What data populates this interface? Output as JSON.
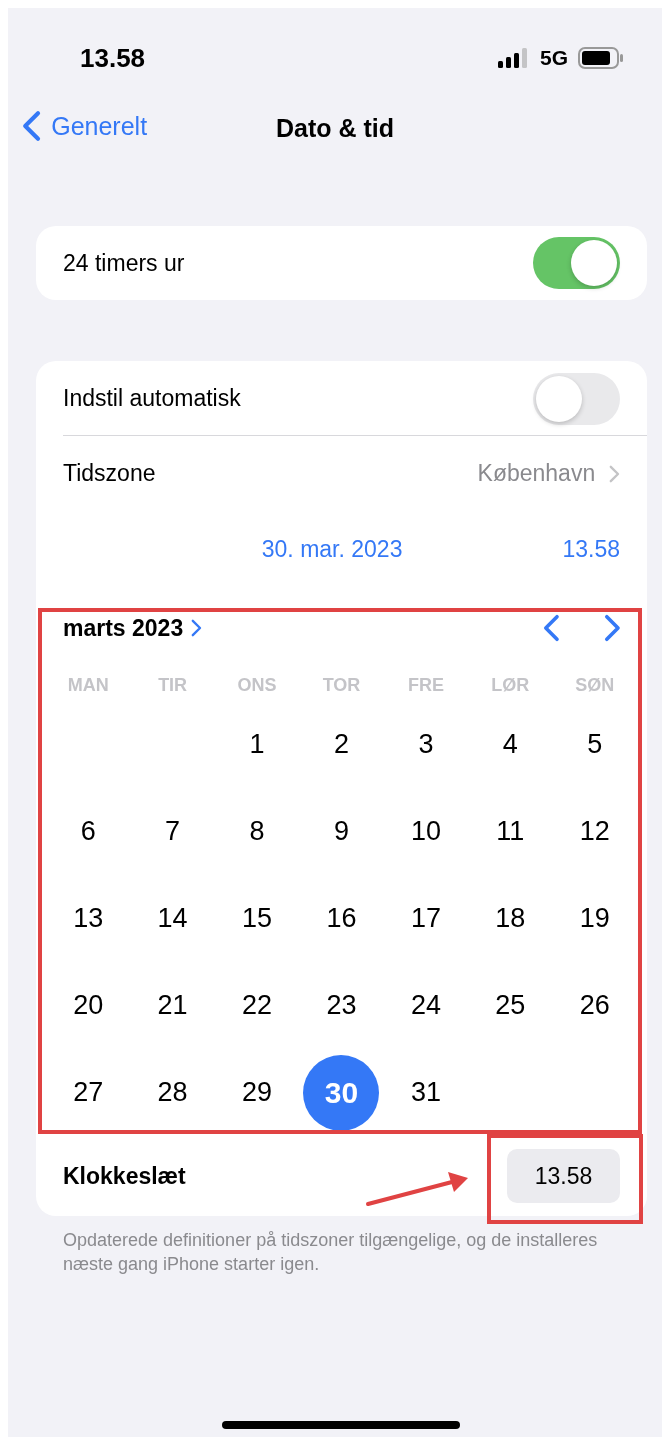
{
  "status_bar": {
    "time": "13.58",
    "network": "5G"
  },
  "nav": {
    "back": "Generelt",
    "title": "Dato & tid"
  },
  "clock_card": {
    "label": "24 timers ur",
    "on": true
  },
  "settings": {
    "auto": {
      "label": "Indstil automatisk",
      "on": false
    },
    "timezone": {
      "label": "Tidszone",
      "value": "København"
    },
    "date": "30. mar. 2023",
    "time": "13.58"
  },
  "calendar": {
    "month": "marts 2023",
    "weekdays": [
      "MAN",
      "TIR",
      "ONS",
      "TOR",
      "FRE",
      "LØR",
      "SØN"
    ],
    "weeks": [
      [
        {
          "kind": "blank"
        },
        {
          "kind": "blank"
        },
        {
          "kind": "day",
          "label": "1",
          "selected": false
        },
        {
          "label": "2",
          "selected": false
        },
        {
          "label": "3",
          "selected": false
        },
        {
          "label": "4",
          "selected": false
        },
        {
          "label": "5",
          "selected": false
        }
      ],
      [
        {
          "label": "6",
          "selected": false
        },
        {
          "label": "7",
          "selected": false
        },
        {
          "label": "8",
          "selected": false
        },
        {
          "label": "9",
          "selected": false
        },
        {
          "label": "10",
          "selected": false
        },
        {
          "label": "11",
          "selected": false
        },
        {
          "label": "12",
          "selected": false
        }
      ],
      [
        {
          "label": "13",
          "selected": false
        },
        {
          "label": "14",
          "selected": false
        },
        {
          "label": "15",
          "selected": false
        },
        {
          "label": "16",
          "selected": false
        },
        {
          "label": "17",
          "selected": false
        },
        {
          "label": "18",
          "selected": false
        },
        {
          "label": "19",
          "selected": false
        }
      ],
      [
        {
          "label": "20",
          "selected": false
        },
        {
          "label": "21",
          "selected": false
        },
        {
          "label": "22",
          "selected": false
        },
        {
          "label": "23",
          "selected": false
        },
        {
          "label": "24",
          "selected": false
        },
        {
          "label": "25",
          "selected": false
        },
        {
          "label": "26",
          "selected": false
        }
      ],
      [
        {
          "label": "27",
          "selected": false
        },
        {
          "label": "28",
          "selected": false
        },
        {
          "label": "29",
          "selected": false
        },
        {
          "label": "30",
          "selected": true
        },
        {
          "label": "31",
          "selected": false
        },
        {
          "kind": "blank"
        },
        {
          "kind": "blank"
        }
      ]
    ]
  },
  "time_row": {
    "label": "Klokkeslæt",
    "value": "13.58"
  },
  "footnote": "Opdaterede definitioner på tidszoner tilgængelige, og de installeres næste gang iPhone starter igen.",
  "annotations": [
    {
      "kind": "box"
    },
    {
      "kind": "box"
    },
    {
      "kind": "arrow"
    }
  ]
}
